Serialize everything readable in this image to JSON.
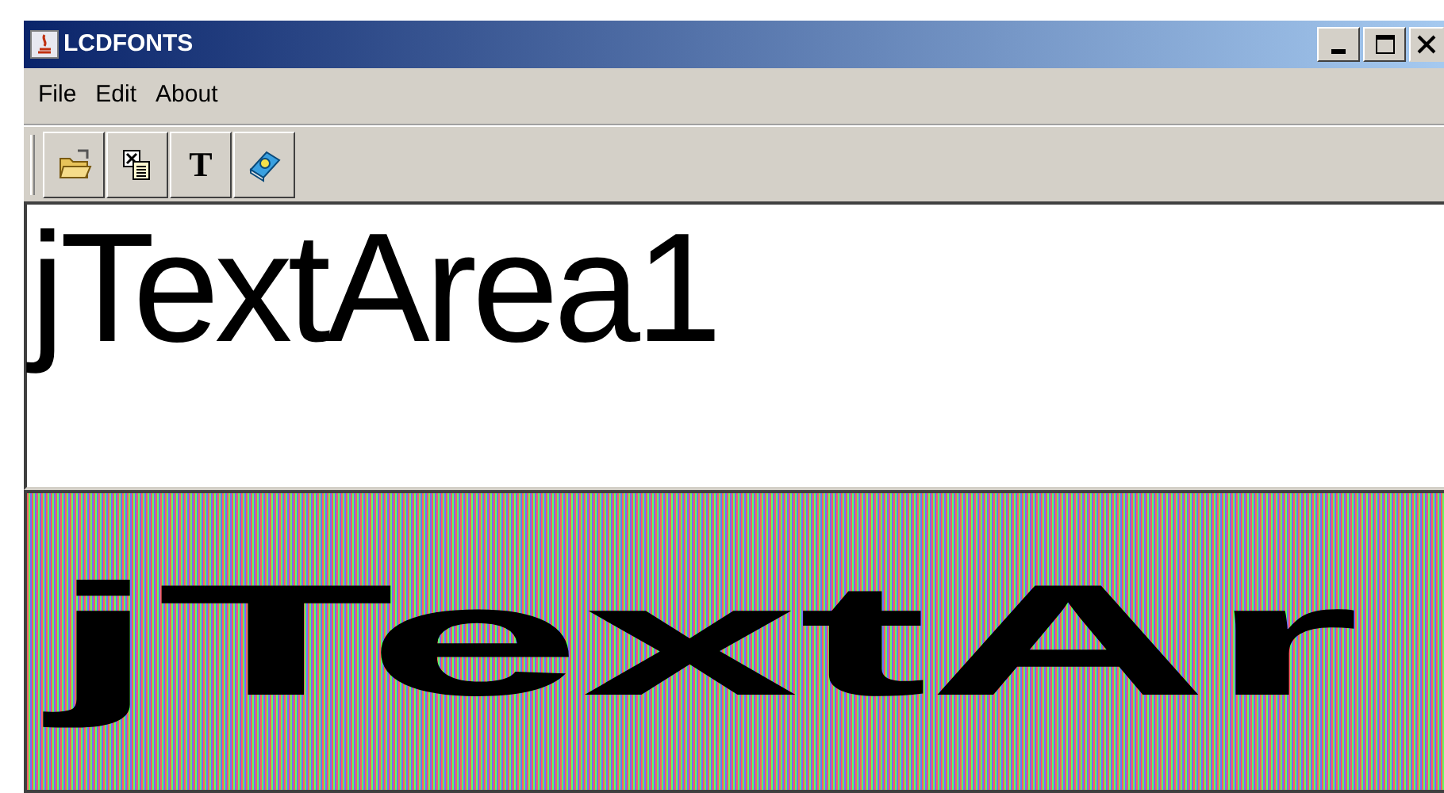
{
  "window": {
    "title": "LCDFONTS"
  },
  "menu": [
    "File",
    "Edit",
    "About"
  ],
  "toolbar": [
    {
      "kind": "open"
    },
    {
      "kind": "paste"
    },
    {
      "kind": "text",
      "label": "T"
    },
    {
      "kind": "help"
    }
  ],
  "text_area": {
    "value": "jTextArea1"
  },
  "lcd_preview": {
    "text": "jTextAr"
  }
}
